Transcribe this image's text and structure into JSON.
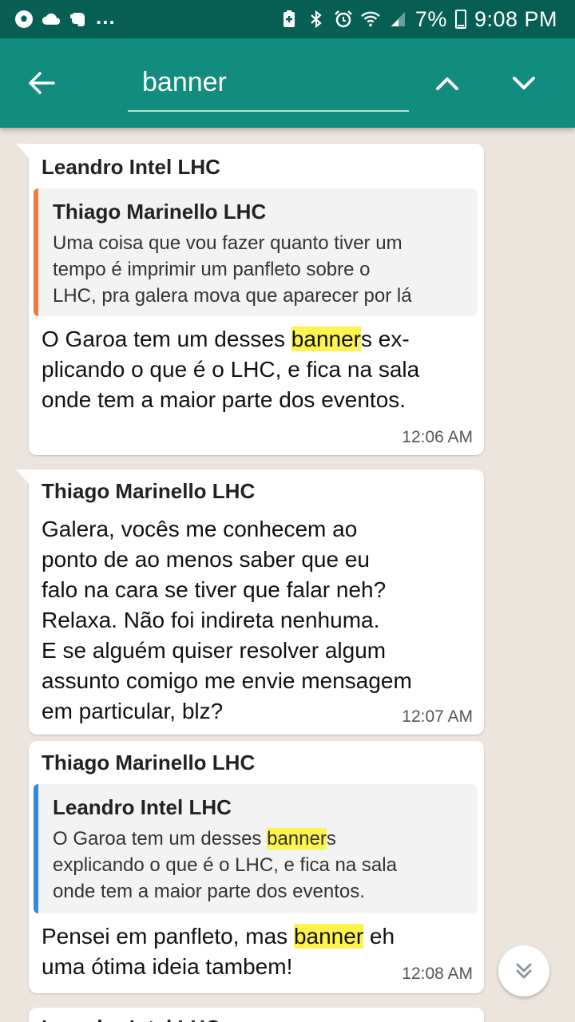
{
  "status_bar": {
    "left_icons": [
      "soccer-ball-icon",
      "cloud-icon",
      "evernote-elephant-icon"
    ],
    "more": "...",
    "battery_percent": "7%",
    "time": "9:08 PM"
  },
  "app_bar": {
    "search_value": "banner",
    "colors": {
      "header": "#128c7e",
      "status": "#075e54",
      "highlight": "#fff44f"
    }
  },
  "messages": [
    {
      "sender": "Leandro Intel LHC",
      "quote": {
        "sender": "Thiago Marinello LHC",
        "lines": [
          "Uma coisa que vou fazer quanto tiver um",
          "tempo é imprimir um panfleto sobre o",
          "LHC, pra galera mova que aparecer por lá"
        ],
        "bar_color": "#f07c3c"
      },
      "body_lines": [
        {
          "pre": "O Garoa tem um desses ",
          "hl": "banner",
          "post": "s ex-"
        },
        {
          "pre": "plicando o que é o LHC, e fica na sala",
          "hl": "",
          "post": ""
        },
        {
          "pre": "onde tem a maior parte dos eventos.",
          "hl": "",
          "post": ""
        }
      ],
      "time": "12:06 AM"
    },
    {
      "sender": "Thiago Marinello LHC",
      "body_lines": [
        "Galera, vocês me conhecem ao",
        "ponto de ao menos saber que eu",
        "falo na cara se tiver que falar neh?",
        "Relaxa. Não foi indireta nenhuma.",
        "E se alguém quiser resolver algum",
        "assunto comigo me envie mensagem",
        "em particular, blz?"
      ],
      "time": "12:07 AM"
    },
    {
      "sender": "Thiago Marinello LHC",
      "quote": {
        "sender": "Leandro Intel LHC",
        "line1_pre": "O Garoa tem um desses ",
        "line1_hl": "banner",
        "line1_post": "s",
        "line2": "explicando o que é o LHC, e fica na sala",
        "line3": "onde tem a maior parte dos eventos.",
        "bar_color": "#2f8be0"
      },
      "body_line1_pre": "Pensei em panfleto, mas ",
      "body_line1_hl": "banner",
      "body_line1_post": " eh",
      "body_line2": "uma ótima ideia tambem!",
      "time": "12:08 AM"
    },
    {
      "sender": "Leandro Intel LHC"
    }
  ]
}
